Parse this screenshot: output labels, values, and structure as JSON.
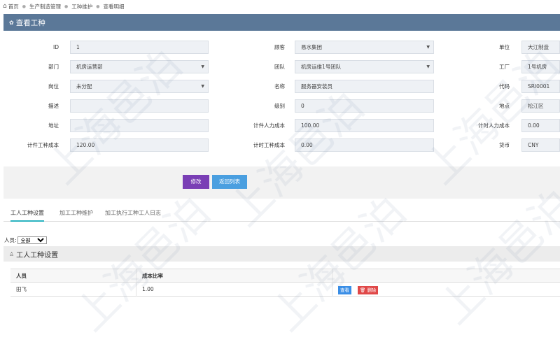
{
  "breadcrumb": {
    "items": [
      "首页",
      "生产制造管理",
      "工种维护",
      "查看明细"
    ]
  },
  "page_title": "查看工种",
  "form": {
    "id": {
      "label": "ID",
      "value": "1"
    },
    "customer": {
      "label": "顾客",
      "value": "易水集团"
    },
    "unit": {
      "label": "单位",
      "value": "大江制造"
    },
    "department": {
      "label": "部门",
      "value": "机房运营部"
    },
    "team": {
      "label": "团队",
      "value": "机房运维1号团队"
    },
    "factory": {
      "label": "工厂",
      "value": "1号机房"
    },
    "position": {
      "label": "岗位",
      "value": "未分配"
    },
    "name": {
      "label": "名称",
      "value": "服务器安装员"
    },
    "code": {
      "label": "代码",
      "value": "SRI0001"
    },
    "description": {
      "label": "描述",
      "value": ""
    },
    "level": {
      "label": "级别",
      "value": "0"
    },
    "location": {
      "label": "地点",
      "value": "松江区"
    },
    "address": {
      "label": "地址",
      "value": ""
    },
    "piece_labor_cost": {
      "label": "计件人力成本",
      "value": "100.00"
    },
    "hourly_labor_cost": {
      "label": "计时人力成本",
      "value": "0.00"
    },
    "piece_type_cost": {
      "label": "计件工种成本",
      "value": "120.00"
    },
    "hourly_type_cost": {
      "label": "计时工种成本",
      "value": "0.00"
    },
    "currency": {
      "label": "货币",
      "value": "CNY"
    }
  },
  "actions": {
    "edit": "修改",
    "back": "返回列表"
  },
  "tabs": [
    "工人工种设置",
    "加工工种维护",
    "加工执行工种工人日志"
  ],
  "filter": {
    "label": "人员:",
    "selected": "全部"
  },
  "section_title": "工人工种设置",
  "table": {
    "headers": [
      "人员",
      "成本比率",
      ""
    ],
    "rows": [
      {
        "person": "田飞",
        "ratio": "1.00",
        "view": "查看",
        "delete": "删除"
      }
    ]
  },
  "watermark": "上海邑泊",
  "colors": {
    "titlebar": "#5b7898",
    "edit_button": "#7a3fb5",
    "back_button": "#4a9fe0",
    "tab_active": "#2bb3c0",
    "delete_button": "#e04848"
  }
}
